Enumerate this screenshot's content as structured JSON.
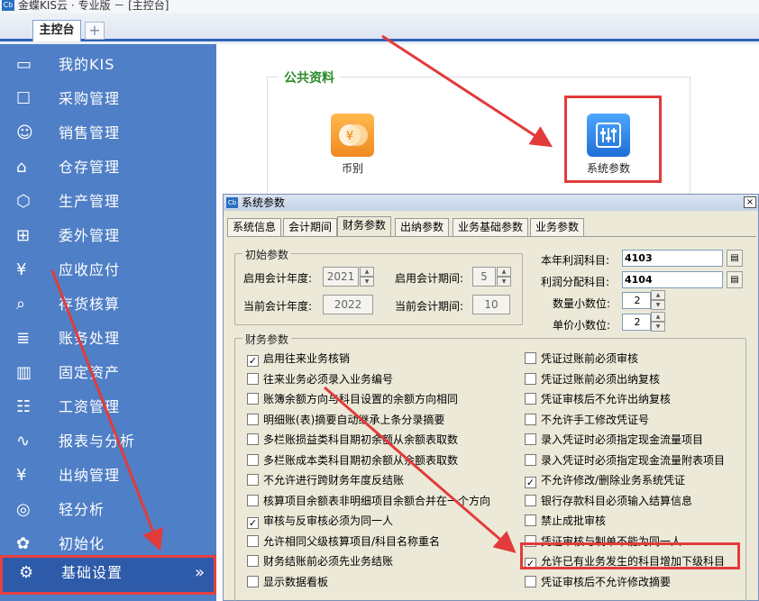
{
  "window": {
    "title": "金蝶KIS云 · 专业版 － [主控台]"
  },
  "tabs": {
    "main": "主控台",
    "add": "+"
  },
  "sidebar": {
    "items": [
      {
        "label": "我的KIS",
        "icon": "monitor-icon"
      },
      {
        "label": "采购管理",
        "icon": "purchase-icon"
      },
      {
        "label": "销售管理",
        "icon": "sales-icon"
      },
      {
        "label": "仓存管理",
        "icon": "warehouse-icon"
      },
      {
        "label": "生产管理",
        "icon": "production-icon"
      },
      {
        "label": "委外管理",
        "icon": "outsource-icon"
      },
      {
        "label": "应收应付",
        "icon": "receivable-icon"
      },
      {
        "label": "存货核算",
        "icon": "inventory-icon"
      },
      {
        "label": "账务处理",
        "icon": "accounting-icon"
      },
      {
        "label": "固定资产",
        "icon": "assets-icon"
      },
      {
        "label": "工资管理",
        "icon": "salary-icon"
      },
      {
        "label": "报表与分析",
        "icon": "report-icon"
      },
      {
        "label": "出纳管理",
        "icon": "cashier-icon"
      },
      {
        "label": "轻分析",
        "icon": "analysis-icon"
      },
      {
        "label": "初始化",
        "icon": "init-icon"
      },
      {
        "label": "基础设置",
        "icon": "gear-icon",
        "active": true
      }
    ],
    "active_arrow": "»"
  },
  "main": {
    "group_title": "公共资料",
    "tiles": [
      {
        "label": "币别",
        "icon": "currency-icon"
      },
      {
        "label": "系统参数",
        "icon": "system-params-icon"
      }
    ]
  },
  "dialog": {
    "title": "系统参数",
    "close": "×",
    "tabs": [
      "系统信息",
      "会计期间",
      "财务参数",
      "出纳参数",
      "业务基础参数",
      "业务参数"
    ],
    "selected_tab": "财务参数",
    "init": {
      "legend": "初始参数",
      "start_year_label": "启用会计年度:",
      "start_year": "2021",
      "start_period_label": "启用会计期间:",
      "start_period": "5",
      "current_year_label": "当前会计年度:",
      "current_year": "2022",
      "current_period_label": "当前会计期间:",
      "current_period": "10"
    },
    "right": {
      "profit_account_label": "本年利润科目:",
      "profit_account": "4103",
      "distribution_account_label": "利润分配科目:",
      "distribution_account": "4104",
      "qty_decimals_label": "数量小数位:",
      "qty_decimals": "2",
      "price_decimals_label": "单价小数位:",
      "price_decimals": "2"
    },
    "finance": {
      "legend": "财务参数",
      "left_options": [
        {
          "label": "启用往来业务核销",
          "checked": true
        },
        {
          "label": "往来业务必须录入业务编号",
          "checked": false
        },
        {
          "label": "账簿余额方向与科目设置的余额方向相同",
          "checked": false
        },
        {
          "label": "明细账(表)摘要自动继承上条分录摘要",
          "checked": false
        },
        {
          "label": "多栏账损益类科目期初余额从余额表取数",
          "checked": false
        },
        {
          "label": "多栏账成本类科目期初余额从余额表取数",
          "checked": false
        },
        {
          "label": "不允许进行跨财务年度反结账",
          "checked": false
        },
        {
          "label": "核算项目余额表非明细项目余额合并在一个方向",
          "checked": false
        },
        {
          "label": "审核与反审核必须为同一人",
          "checked": true
        },
        {
          "label": "允许相同父级核算项目/科目名称重名",
          "checked": false
        },
        {
          "label": "财务结账前必须先业务结账",
          "checked": false
        },
        {
          "label": "显示数据看板",
          "checked": false
        }
      ],
      "right_options": [
        {
          "label": "凭证过账前必须审核",
          "checked": false
        },
        {
          "label": "凭证过账前必须出纳复核",
          "checked": false
        },
        {
          "label": "凭证审核后不允许出纳复核",
          "checked": false
        },
        {
          "label": "不允许手工修改凭证号",
          "checked": false
        },
        {
          "label": "录入凭证时必须指定现金流量项目",
          "checked": false
        },
        {
          "label": "录入凭证时必须指定现金流量附表项目",
          "checked": false
        },
        {
          "label": "不允许修改/删除业务系统凭证",
          "checked": true
        },
        {
          "label": "银行存款科目必须输入结算信息",
          "checked": false
        },
        {
          "label": "禁止成批审核",
          "checked": false
        },
        {
          "label": "凭证审核与制单不能为同一人",
          "checked": false
        },
        {
          "label": "允许已有业务发生的科目增加下级科目",
          "checked": true
        },
        {
          "label": "凭证审核后不允许修改摘要",
          "checked": false
        }
      ]
    }
  },
  "colors": {
    "sidebar": "#4f7fc6",
    "active": "#2d5aa9",
    "highlight": "#e23b3b",
    "group_title": "#2c8a2c"
  }
}
